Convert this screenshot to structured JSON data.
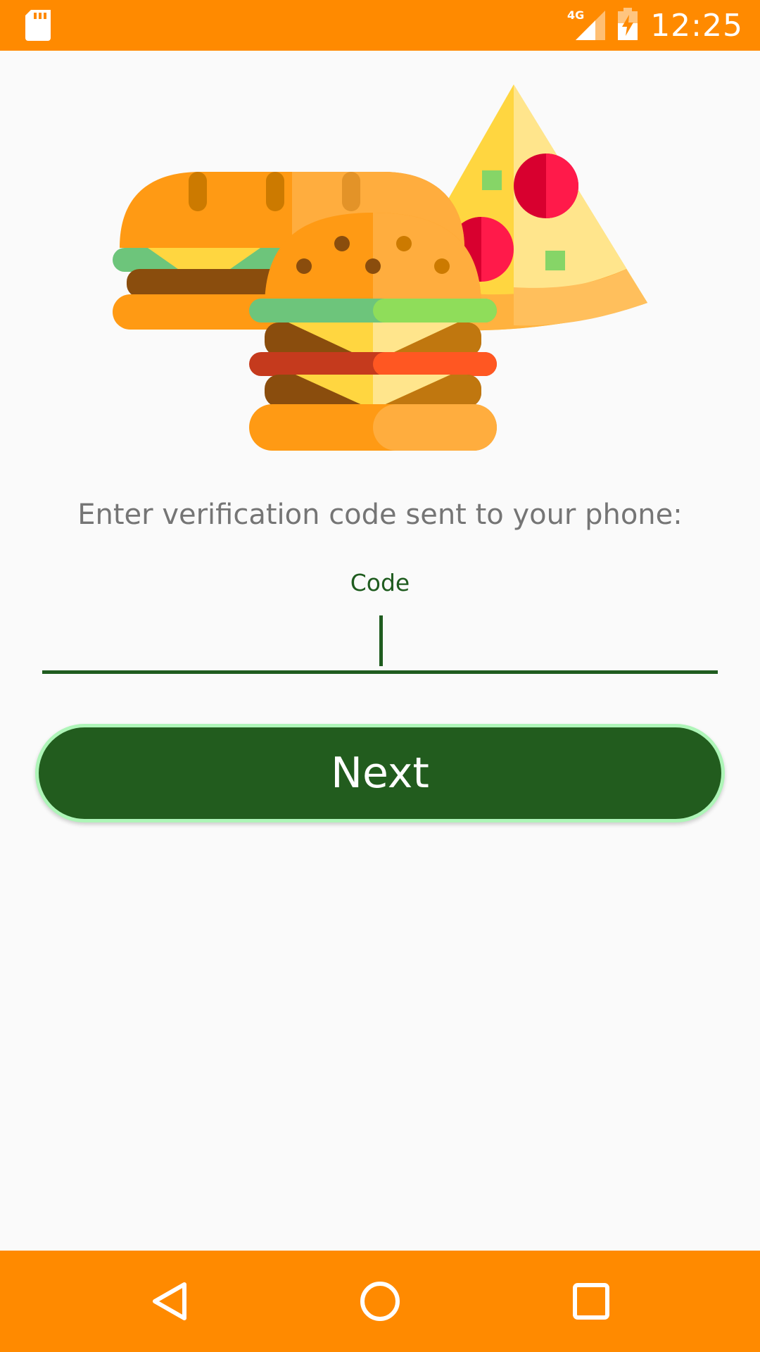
{
  "status_bar": {
    "network": "4G",
    "time": "12:25",
    "icons": [
      "sd-card-icon",
      "signal-icon",
      "battery-charging-icon"
    ]
  },
  "illustration": {
    "name": "food-illustration",
    "items": [
      "burger",
      "burger",
      "pizza-slice"
    ]
  },
  "verification": {
    "prompt": "Enter verification code sent to your phone:",
    "field_label": "Code",
    "field_value": "",
    "next_label": "Next"
  },
  "navigation_bar": {
    "icons": [
      "back-icon",
      "home-icon",
      "recents-icon"
    ]
  },
  "colors": {
    "accent_orange": "#ff8a00",
    "primary_green": "#225c1e",
    "button_border": "#aef5b8",
    "prompt_gray": "#757575",
    "background": "#fafafa"
  }
}
